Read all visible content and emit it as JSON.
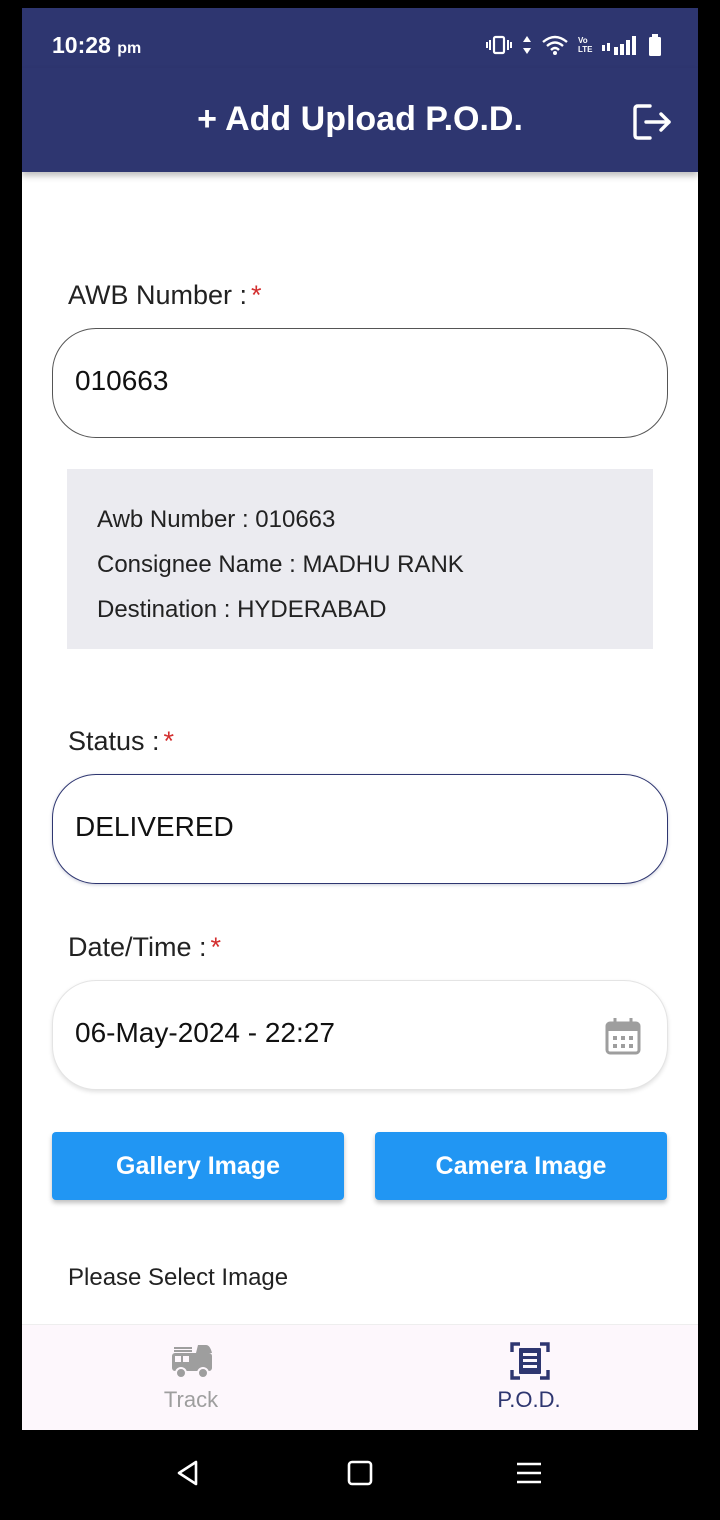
{
  "status_bar": {
    "time": "10:28",
    "time_suffix": "pm",
    "volte": "Vo LTE"
  },
  "app_bar": {
    "title": "+ Add Upload P.O.D.",
    "bg_color": "#2e3670"
  },
  "form": {
    "awb": {
      "label": "AWB Number :",
      "required": "*",
      "value": "010663"
    },
    "info": {
      "awb_line": "Awb Number : 010663",
      "consignee_line": "Consignee Name : MADHU RANK",
      "destination_line": "Destination : HYDERABAD"
    },
    "status": {
      "label": "Status :",
      "required": "*",
      "value": "DELIVERED"
    },
    "datetime": {
      "label": "Date/Time :",
      "required": "*",
      "value": "06-May-2024 - 22:27"
    },
    "gallery_button": "Gallery Image",
    "camera_button": "Camera Image",
    "hint": "Please Select Image"
  },
  "bottom_nav": {
    "items": [
      {
        "label": "Track",
        "icon": "fire-truck-icon",
        "active": false
      },
      {
        "label": "P.O.D.",
        "icon": "document-scanner-icon",
        "active": true
      }
    ]
  },
  "colors": {
    "primary": "#2e3670",
    "button": "#2196f3",
    "required": "#d32f2f"
  }
}
